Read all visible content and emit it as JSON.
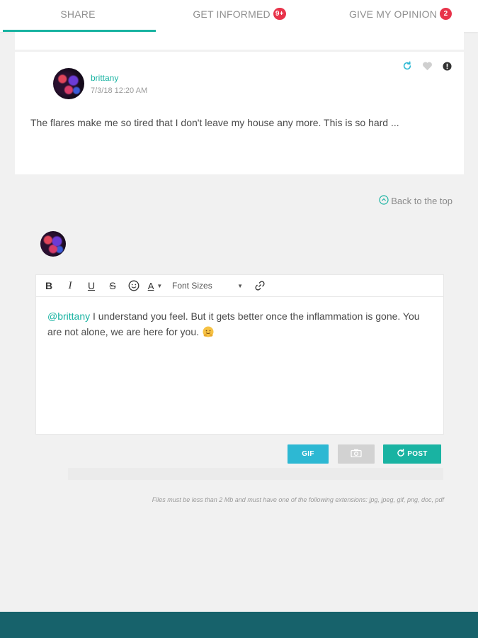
{
  "tabs": [
    {
      "label": "SHARE",
      "badge": ""
    },
    {
      "label": "GET INFORMED",
      "badge": "9+"
    },
    {
      "label": "GIVE MY OPINION",
      "badge": "2"
    }
  ],
  "active_tab": "SHARE",
  "post": {
    "author": "brittany",
    "timestamp": "7/3/18 12:20 AM",
    "text": "The flares make me so tired that I don't leave my house any more. This is so hard ...",
    "actions": [
      "refresh-icon",
      "heart-icon",
      "info-icon"
    ]
  },
  "back_to_top": "Back to the top",
  "editor": {
    "toolbar": {
      "bold": "B",
      "italic": "I",
      "underline": "U",
      "strike": "S",
      "text_color": "A",
      "font_sizes": "Font Sizes"
    },
    "mention": "@brittany",
    "body": " I understand you feel. But it gets better once the inflammation is gone. You are not alone, we are here for you. "
  },
  "buttons": {
    "gif": "GIF",
    "post": "POST"
  },
  "file_note": "Files must be less than 2 Mb and must have one of the following extensions: jpg, jpeg, gif, png, doc, pdf",
  "colors": {
    "accent": "#19b3a2",
    "badge": "#e8334a",
    "gif_button": "#2db8d3",
    "footer": "#17626b"
  }
}
